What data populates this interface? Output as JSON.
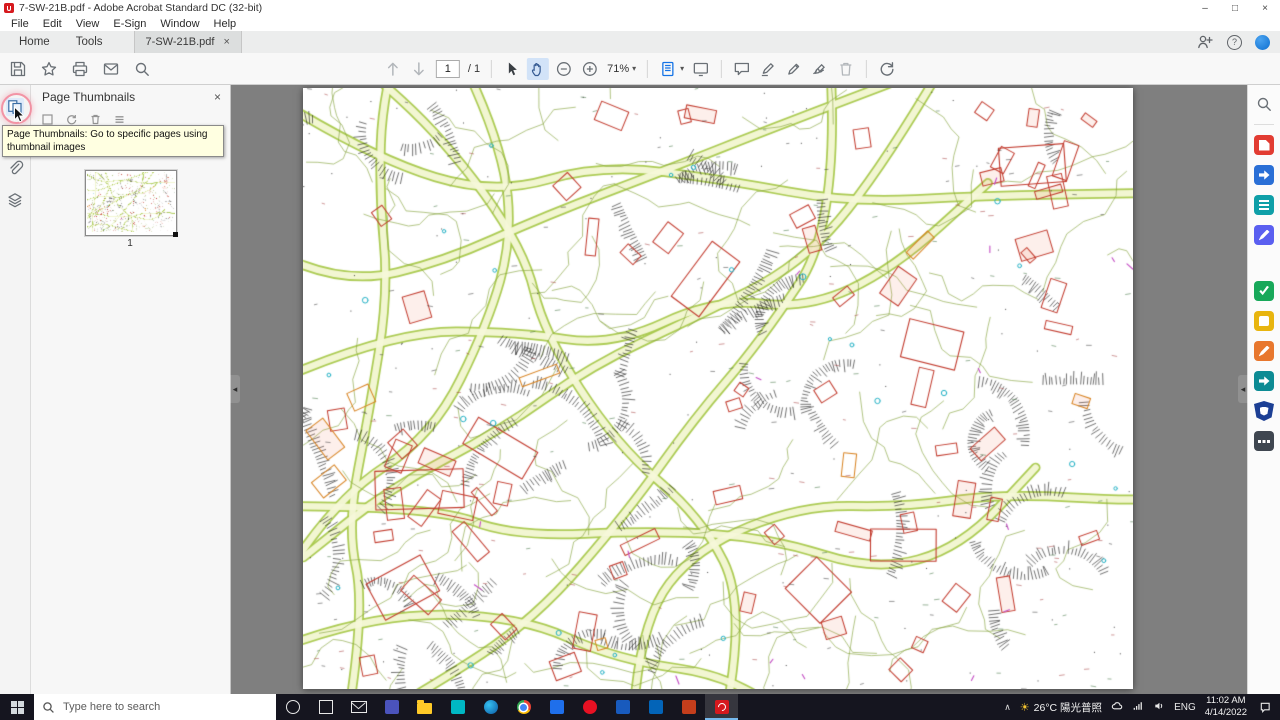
{
  "titlebar": {
    "app_title": "7-SW-21B.pdf - Adobe Acrobat Standard DC (32-bit)"
  },
  "icons": {
    "minimize": "–",
    "maximize": "□",
    "close": "×",
    "close_small": "×",
    "caret_down": "▾",
    "chevron_collapse": "◂",
    "tray_chevron": "∧",
    "sun": "☀",
    "help": "?"
  },
  "menu": {
    "items": [
      {
        "label": "File"
      },
      {
        "label": "Edit"
      },
      {
        "label": "View"
      },
      {
        "label": "E-Sign"
      },
      {
        "label": "Window"
      },
      {
        "label": "Help"
      }
    ]
  },
  "tabbar": {
    "home": "Home",
    "tools": "Tools",
    "document_tab": "7-SW-21B.pdf"
  },
  "toolbar": {
    "page_number": "1",
    "page_total": "/ 1",
    "zoom_level": "71%"
  },
  "thumbnails_panel": {
    "title": "Page Thumbnails",
    "tooltip": "Page Thumbnails: Go to specific pages using thumbnail images",
    "page_label": "1"
  },
  "taskbar": {
    "search_placeholder": "Type here to search",
    "weather": "26°C 陽光普照",
    "language": "ENG",
    "time": "11:02 AM",
    "date": "4/14/2022"
  },
  "colors": {
    "acrobat_red": "#d6191e",
    "accent_blue": "#1473e6",
    "taskbar_bg": "#15151f",
    "tooltip_bg": "#ffffe1",
    "weather_sun": "#f4c430"
  }
}
